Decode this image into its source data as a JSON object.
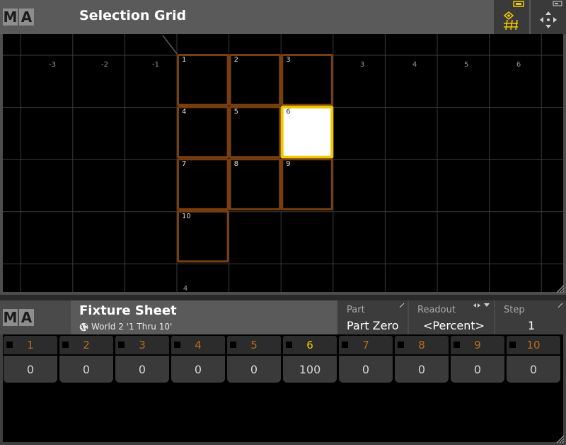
{
  "logo": {
    "m": "M",
    "a": "A"
  },
  "selection_grid": {
    "title": "Selection Grid",
    "toolbar": {
      "grid_tool_icon": "selection-grid-tool-icon",
      "move_icon": "move-arrows-icon"
    },
    "x_axis_labels": [
      "-3",
      "-2",
      "-1",
      "3",
      "4",
      "5",
      "6"
    ],
    "bottom_label": "4",
    "fixtures": [
      {
        "id": "1",
        "selected": false
      },
      {
        "id": "2",
        "selected": false
      },
      {
        "id": "3",
        "selected": false
      },
      {
        "id": "4",
        "selected": false
      },
      {
        "id": "5",
        "selected": false
      },
      {
        "id": "6",
        "selected": true
      },
      {
        "id": "7",
        "selected": false
      },
      {
        "id": "8",
        "selected": false
      },
      {
        "id": "9",
        "selected": false
      },
      {
        "id": "10",
        "selected": false
      }
    ],
    "colors": {
      "cell_border": "#7a3f10",
      "selected_border": "#f0c800",
      "selected_fill": "#ffffff",
      "grid_line": "#3a3a3a"
    }
  },
  "fixture_sheet": {
    "title": "Fixture Sheet",
    "subtitle": "World 2 '1 Thru 10'",
    "options": {
      "part_label": "Part",
      "part_value": "Part Zero",
      "readout_label": "Readout",
      "readout_value": "<Percent>",
      "step_label": "Step",
      "step_value": "1"
    },
    "columns": [
      {
        "id": "1",
        "value": "0",
        "selected": false
      },
      {
        "id": "2",
        "value": "0",
        "selected": false
      },
      {
        "id": "3",
        "value": "0",
        "selected": false
      },
      {
        "id": "4",
        "value": "0",
        "selected": false
      },
      {
        "id": "5",
        "value": "0",
        "selected": false
      },
      {
        "id": "6",
        "value": "100",
        "selected": true
      },
      {
        "id": "7",
        "value": "0",
        "selected": false
      },
      {
        "id": "8",
        "value": "0",
        "selected": false
      },
      {
        "id": "9",
        "value": "0",
        "selected": false
      },
      {
        "id": "10",
        "value": "0",
        "selected": false
      }
    ],
    "colors": {
      "id_normal": "#b86e1e",
      "id_selected": "#f0cc00"
    }
  }
}
